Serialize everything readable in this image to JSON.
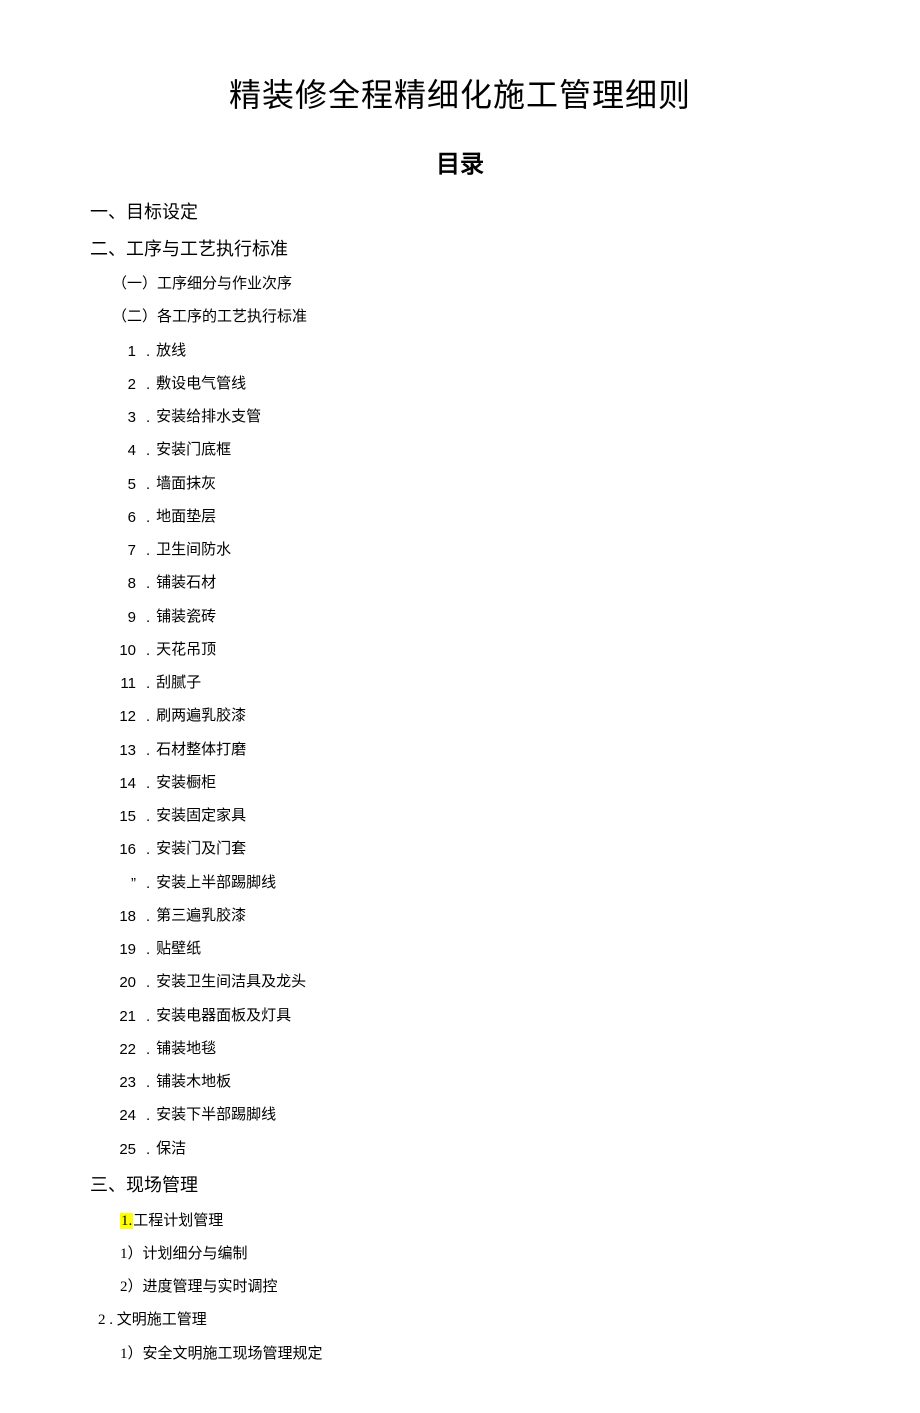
{
  "title": "精装修全程精细化施工管理细则",
  "subtitle": "目录",
  "sections": {
    "s1": "一、目标设定",
    "s2": "二、工序与工艺执行标准",
    "s2_1": "（一）工序细分与作业次序",
    "s2_2": "（二）各工序的工艺执行标准",
    "items": [
      {
        "n": "1",
        "t": "放线"
      },
      {
        "n": "2",
        "t": "敷设电气管线"
      },
      {
        "n": "3",
        "t": "安装给排水支管"
      },
      {
        "n": "4",
        "t": "安装门底框"
      },
      {
        "n": "5",
        "t": "墙面抹灰"
      },
      {
        "n": "6",
        "t": "地面垫层"
      },
      {
        "n": "7",
        "t": "卫生间防水"
      },
      {
        "n": "8",
        "t": "铺装石材"
      },
      {
        "n": "9",
        "t": "铺装瓷砖"
      },
      {
        "n": "10",
        "t": "天花吊顶"
      },
      {
        "n": "11",
        "t": "刮腻子"
      },
      {
        "n": "12",
        "t": "刷两遍乳胶漆"
      },
      {
        "n": "13",
        "t": "石材整体打磨"
      },
      {
        "n": "14",
        "t": "安装橱柜"
      },
      {
        "n": "15",
        "t": "安装固定家具"
      },
      {
        "n": "16",
        "t": "安装门及门套"
      },
      {
        "n": "”",
        "t": "安装上半部踢脚线"
      },
      {
        "n": "18",
        "t": "第三遍乳胶漆"
      },
      {
        "n": "19",
        "t": "贴壁纸"
      },
      {
        "n": "20",
        "t": "安装卫生间洁具及龙头"
      },
      {
        "n": "21",
        "t": "安装电器面板及灯具"
      },
      {
        "n": "22",
        "t": "铺装地毯"
      },
      {
        "n": "23",
        "t": "铺装木地板"
      },
      {
        "n": "24",
        "t": "安装下半部踢脚线"
      },
      {
        "n": "25",
        "t": "保洁"
      }
    ],
    "s3": "三、现场管理",
    "s3_1_num": "1.",
    "s3_1_txt": "工程计划管理",
    "s3_1_1": "1）计划细分与编制",
    "s3_1_2": "2）进度管理与实时调控",
    "s3_2": "2  . 文明施工管理",
    "s3_2_1": "1）安全文明施工现场管理规定"
  }
}
